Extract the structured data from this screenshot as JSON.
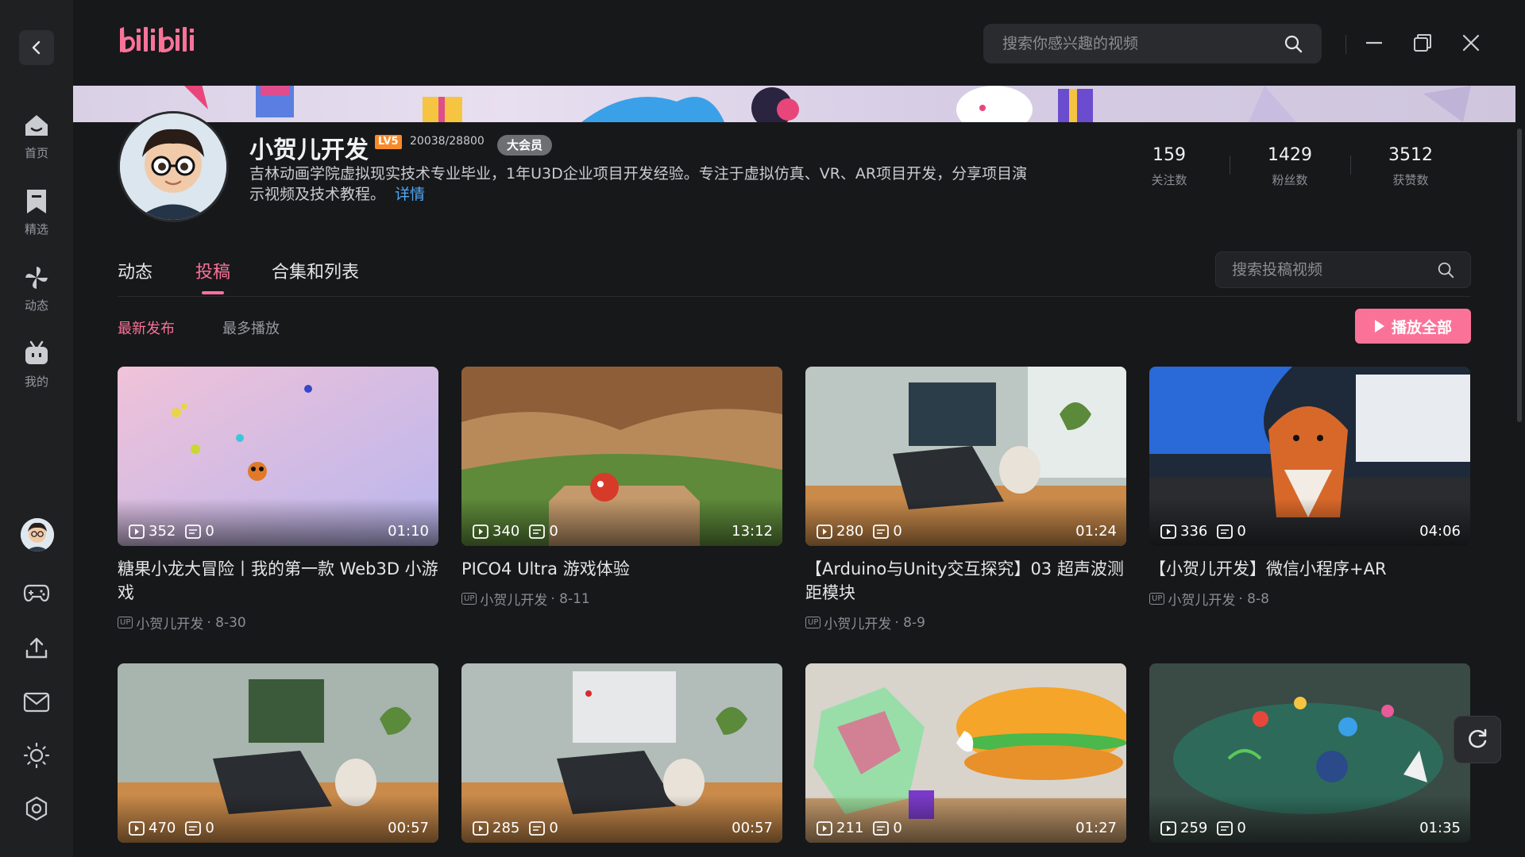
{
  "app": {
    "logo_text": "bilibili"
  },
  "top": {
    "search_placeholder": "搜索你感兴趣的视频"
  },
  "sidebar": {
    "items": [
      {
        "label": "首页",
        "icon": "home-icon"
      },
      {
        "label": "精选",
        "icon": "bookmark-icon"
      },
      {
        "label": "动态",
        "icon": "pinwheel-icon"
      },
      {
        "label": "我的",
        "icon": "tv-icon"
      }
    ]
  },
  "profile": {
    "name": "小贺儿开发",
    "level": "LV5",
    "exp": "20038/28800",
    "vip": "大会员",
    "bio": "吉林动画学院虚拟现实技术专业毕业，1年U3D企业项目开发经验。专注于虚拟仿真、VR、AR项目开发，分享项目演示视频及技术教程。",
    "bio_link": "详情",
    "stats": [
      {
        "num": "159",
        "label": "关注数"
      },
      {
        "num": "1429",
        "label": "粉丝数"
      },
      {
        "num": "3512",
        "label": "获赞数"
      }
    ]
  },
  "tabs": [
    "动态",
    "投稿",
    "合集和列表"
  ],
  "sub_search_placeholder": "搜索投稿视频",
  "sort": {
    "latest": "最新发布",
    "most": "最多播放"
  },
  "play_all": "播放全部",
  "videos": [
    {
      "plays": "352",
      "danmaku": "0",
      "duration": "01:10",
      "title": "糖果小龙大冒险丨我的第一款 Web3D 小游戏",
      "author": "小贺儿开发",
      "date": "· 8-30"
    },
    {
      "plays": "340",
      "danmaku": "0",
      "duration": "13:12",
      "title": "PICO4 Ultra 游戏体验",
      "author": "小贺儿开发",
      "date": "· 8-11"
    },
    {
      "plays": "280",
      "danmaku": "0",
      "duration": "01:24",
      "title": "【Arduino与Unity交互探究】03 超声波测距模块",
      "author": "小贺儿开发",
      "date": "· 8-9"
    },
    {
      "plays": "336",
      "danmaku": "0",
      "duration": "04:06",
      "title": "【小贺儿开发】微信小程序+AR",
      "author": "小贺儿开发",
      "date": "· 8-8"
    },
    {
      "plays": "470",
      "danmaku": "0",
      "duration": "00:57"
    },
    {
      "plays": "285",
      "danmaku": "0",
      "duration": "00:57"
    },
    {
      "plays": "211",
      "danmaku": "0",
      "duration": "01:27"
    },
    {
      "plays": "259",
      "danmaku": "0",
      "duration": "01:35"
    }
  ]
}
